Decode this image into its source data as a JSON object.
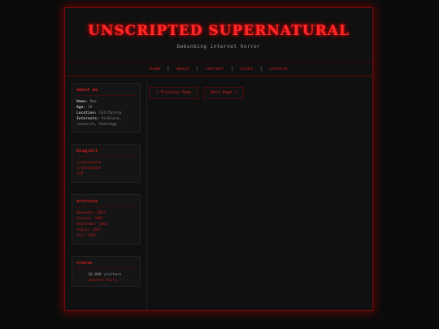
{
  "header": {
    "title": "UNSCRIPTED SUPERNATURAL",
    "tagline": "Debunking internet horror"
  },
  "nav": {
    "items": [
      "home",
      "about",
      "contact",
      "links",
      "contest"
    ]
  },
  "about": {
    "title": "about me",
    "name_label": "Name:",
    "name_value": "Rae",
    "age_label": "Age:",
    "age_value": "28",
    "location_label": "Location:",
    "location_value": "California",
    "interests_label": "Interests:",
    "interests_value": "folklore, research, theology"
  },
  "blogroll": {
    "title": "blogroll",
    "links": [
      "creepypasta",
      "cryptopedia",
      "SCP"
    ]
  },
  "archives": {
    "title": "archives",
    "months": [
      "November 2007",
      "October 2007",
      "September 2007",
      "August 2007",
      "July 2007"
    ]
  },
  "status": {
    "title": "status",
    "visitors": "10,000 visitors",
    "subtext": "updated daily :)"
  },
  "dividers": {
    "symbol": "✦"
  },
  "pager": {
    "previous": "« Previous Page",
    "next": "Next Page »"
  },
  "colors": {
    "accent": "#c41d1d",
    "glow": "#ff2a2a",
    "background": "#0b0b0b"
  }
}
